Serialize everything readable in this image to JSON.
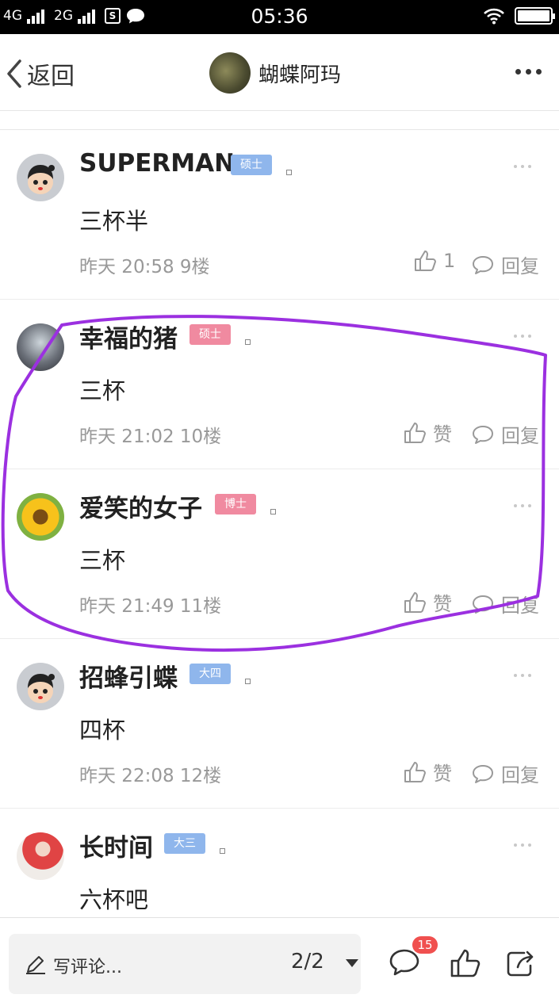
{
  "status_bar": {
    "network1": "4G",
    "network2": "2G",
    "sim_icon": "S",
    "time": "05:36",
    "battery_level": 1.0
  },
  "nav": {
    "back_label": "返回",
    "title": "蝴蝶阿玛"
  },
  "comments": [
    {
      "username": "SUPERMAN",
      "badge": "硕士",
      "badge_color": "#8fb6ec",
      "content": "三杯半",
      "time": "昨天 20:58",
      "floor": "9楼",
      "like_label": "1",
      "reply_label": "回复"
    },
    {
      "username": "幸福的猪",
      "badge": "硕士",
      "badge_color": "#f08aa0",
      "content": "三杯",
      "time": "昨天 21:02",
      "floor": "10楼",
      "like_label": "赞",
      "reply_label": "回复"
    },
    {
      "username": "爱笑的女子",
      "badge": "博士",
      "badge_color": "#f08aa0",
      "content": "三杯",
      "time": "昨天 21:49",
      "floor": "11楼",
      "like_label": "赞",
      "reply_label": "回复"
    },
    {
      "username": "招蜂引蝶",
      "badge": "大四",
      "badge_color": "#8fb6ec",
      "content": "四杯",
      "time": "昨天 22:08",
      "floor": "12楼",
      "like_label": "赞",
      "reply_label": "回复"
    },
    {
      "username": "长时间",
      "badge": "大三",
      "badge_color": "#8fb6ec",
      "content": "六杯吧"
    }
  ],
  "annotation_color": "#9b30e0",
  "bottom_bar": {
    "composer_placeholder": "写评论...",
    "pager": "2/2",
    "comment_count": "15"
  }
}
